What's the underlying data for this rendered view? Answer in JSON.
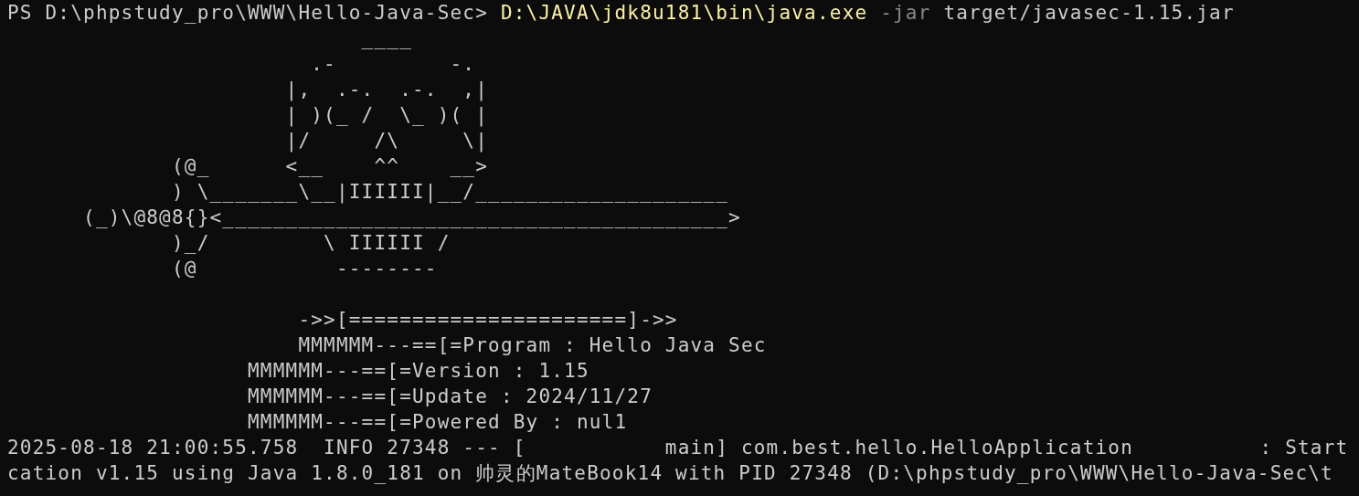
{
  "prompt": {
    "text": "PS D:\\phpstudy_pro\\WWW\\Hello-Java-Sec> ",
    "command": "D:\\JAVA\\jdk8u181\\bin\\java.exe",
    "flag": " -jar",
    "args": " target/javasec-1.15.jar"
  },
  "banner_lines": [
    "                            ____",
    "                        .-         -.",
    "                      |,  .-.  .-.  ,|",
    "                      | )(_ /  \\_ )( |",
    "                      |/     /\\     \\|",
    "             (@_      <__    ^^    __>",
    "             ) \\_______\\__|IIIIII|__/____________________",
    "      (_)\\@8@8{}<________________________________________>",
    "             )_/         \\ IIIIII /",
    "             (@           --------"
  ],
  "info_lines": [
    "                       ->>[======================]->>",
    "                       MMMMMM---==[=Program : Hello Java Sec",
    "                   MMMMMM---==[=Version : 1.15",
    "                   MMMMMM---==[=Update : 2024/11/27",
    "                   MMMMMM---==[=Powered By : nul1"
  ],
  "log_lines": [
    "2025-08-18 21:00:55.758  INFO 27348 --- [           main] com.best.hello.HelloApplication          : Start",
    "cation v1.15 using Java 1.8.0_181 on 帅灵的MateBook14 with PID 27348 (D:\\phpstudy_pro\\WWW\\Hello-Java-Sec\\t"
  ]
}
